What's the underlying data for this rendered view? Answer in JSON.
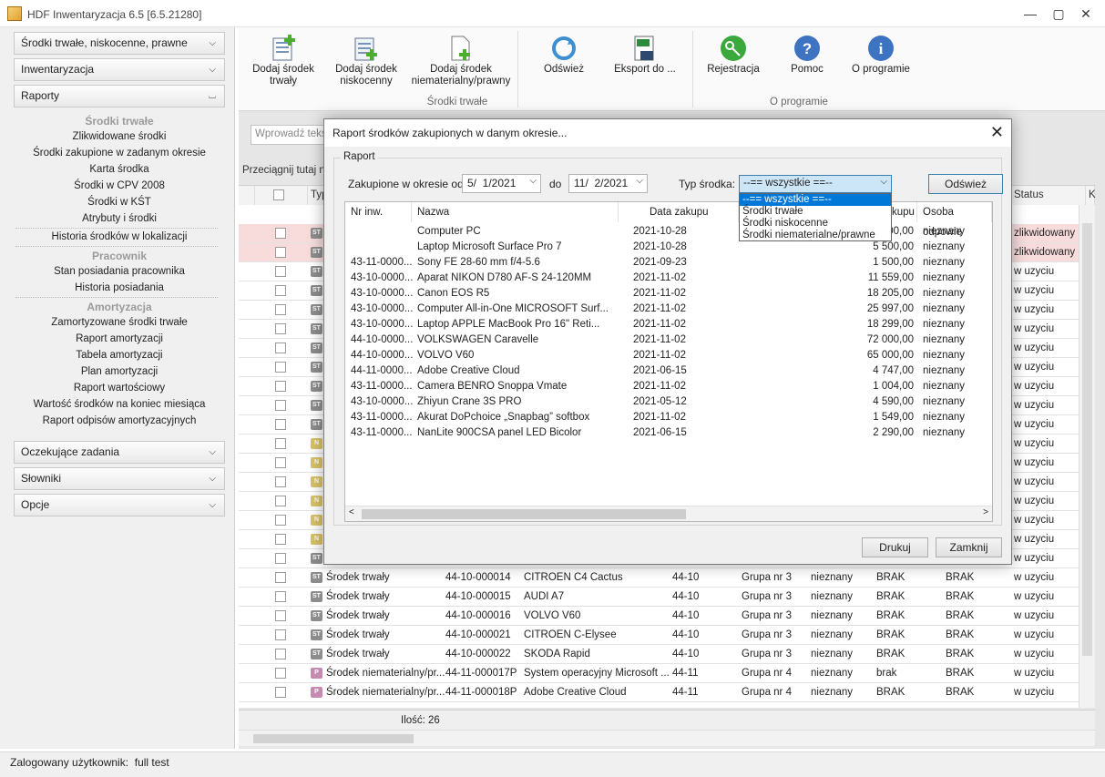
{
  "window": {
    "title": "HDF Inwentaryzacja 6.5 [6.5.21280]"
  },
  "sidebar": {
    "sections": [
      "Środki trwałe, niskocenne, prawne",
      "Inwentaryzacja",
      "Raporty"
    ],
    "groups": [
      "Środki trwałe",
      "Pracownik",
      "Amortyzacja"
    ],
    "links_trwale": [
      "Zlikwidowane środki",
      "Środki zakupione w zadanym okresie",
      "Karta środka",
      "Środki w CPV 2008",
      "Środki w KŚT",
      "Atrybuty i środki",
      "Historia środków w lokalizacji"
    ],
    "links_pracownik": [
      "Stan posiadania pracownika",
      "Historia posiadania"
    ],
    "links_amortyzacja": [
      "Zamortyzowane środki trwałe",
      "Raport amortyzacji",
      "Tabela amortyzacji",
      "Plan amortyzacji",
      "Raport wartościowy",
      "Wartość środków na koniec miesiąca",
      "Raport odpisów amortyzacyjnych"
    ],
    "bottom_sections": [
      "Oczekujące zadania",
      "Słowniki",
      "Opcje"
    ]
  },
  "ribbon": {
    "buttons": [
      {
        "label": "Dodaj środek\ntrwały",
        "icon": "add-fixed-asset-icon"
      },
      {
        "label": "Dodaj środek\nniskocenny",
        "icon": "add-low-value-asset-icon"
      },
      {
        "label": "Dodaj środek\nniematerialny/prawny",
        "icon": "add-intangible-asset-icon"
      },
      {
        "label": "Odśwież",
        "icon": "refresh-icon"
      },
      {
        "label": "Eksport do ...",
        "icon": "export-xls-icon"
      },
      {
        "label": "Rejestracja",
        "icon": "key-icon"
      },
      {
        "label": "Pomoc",
        "icon": "help-icon"
      },
      {
        "label": "O programie",
        "icon": "info-icon"
      }
    ],
    "groups": [
      "Środki trwałe",
      "O programie"
    ]
  },
  "grid": {
    "search_placeholder": "Wprowadź tekst",
    "drag_hint": "Przeciągnij tutaj na",
    "headers": {
      "type": "Typ",
      "status": "Status",
      "k": "K"
    },
    "rows": [
      {
        "badge": "ST",
        "type": "",
        "status": "zlikwidowany",
        "hl": true
      },
      {
        "badge": "ST",
        "type": "",
        "status": "zlikwidowany",
        "hl": true
      },
      {
        "badge": "ST",
        "type": "",
        "status": "w uzyciu"
      },
      {
        "badge": "ST",
        "type": "",
        "status": "w uzyciu"
      },
      {
        "badge": "ST",
        "type": "",
        "status": "w uzyciu"
      },
      {
        "badge": "ST",
        "type": "",
        "status": "w uzyciu"
      },
      {
        "badge": "ST",
        "type": "",
        "status": "w uzyciu"
      },
      {
        "badge": "ST",
        "type": "",
        "status": "w uzyciu"
      },
      {
        "badge": "ST",
        "type": "",
        "status": "w uzyciu"
      },
      {
        "badge": "ST",
        "type": "",
        "status": "w uzyciu"
      },
      {
        "badge": "ST",
        "type": "",
        "status": "w uzyciu"
      },
      {
        "badge": "N",
        "type": "",
        "status": "w uzyciu"
      },
      {
        "badge": "N",
        "type": "",
        "status": "w uzyciu"
      },
      {
        "badge": "N",
        "type": "",
        "status": "w uzyciu"
      },
      {
        "badge": "N",
        "type": "",
        "status": "w uzyciu"
      },
      {
        "badge": "N",
        "type": "",
        "status": "w uzyciu"
      },
      {
        "badge": "N",
        "type": "",
        "status": "w uzyciu"
      },
      {
        "badge": "ST",
        "type": "",
        "status": "w uzyciu"
      },
      {
        "badge": "ST",
        "type": "Środek trwały",
        "inv": "44-10-000014",
        "name": "CITROEN C4 Cactus",
        "kst": "44-10",
        "grp": "Grupa nr 3",
        "o1": "nieznany",
        "o2": "BRAK",
        "o3": "BRAK",
        "status": "w uzyciu"
      },
      {
        "badge": "ST",
        "type": "Środek trwały",
        "inv": "44-10-000015",
        "name": "AUDI A7",
        "kst": "44-10",
        "grp": "Grupa nr 3",
        "o1": "nieznany",
        "o2": "BRAK",
        "o3": "BRAK",
        "status": "w uzyciu"
      },
      {
        "badge": "ST",
        "type": "Środek trwały",
        "inv": "44-10-000016",
        "name": "VOLVO V60",
        "kst": "44-10",
        "grp": "Grupa nr 3",
        "o1": "nieznany",
        "o2": "BRAK",
        "o3": "BRAK",
        "status": "w uzyciu"
      },
      {
        "badge": "ST",
        "type": "Środek trwały",
        "inv": "44-10-000021",
        "name": "CITROEN C-Elysee",
        "kst": "44-10",
        "grp": "Grupa nr 3",
        "o1": "nieznany",
        "o2": "BRAK",
        "o3": "BRAK",
        "status": "w uzyciu"
      },
      {
        "badge": "ST",
        "type": "Środek trwały",
        "inv": "44-10-000022",
        "name": "SKODA Rapid",
        "kst": "44-10",
        "grp": "Grupa nr 3",
        "o1": "nieznany",
        "o2": "BRAK",
        "o3": "BRAK",
        "status": "w uzyciu"
      },
      {
        "badge": "P",
        "type": "Środek niematerialny/pr...",
        "inv": "44-11-000017P",
        "name": "System operacyjny Microsoft ...",
        "kst": "44-11",
        "grp": "Grupa nr 4",
        "o1": "nieznany",
        "o2": "brak",
        "o3": "BRAK",
        "status": "w uzyciu"
      },
      {
        "badge": "P",
        "type": "Środek niematerialny/pr...",
        "inv": "44-11-000018P",
        "name": "Adobe Creative Cloud",
        "kst": "44-11",
        "grp": "Grupa nr 4",
        "o1": "nieznany",
        "o2": "BRAK",
        "o3": "BRAK",
        "status": "w uzyciu"
      }
    ],
    "count": "Ilość: 26"
  },
  "statusbar": {
    "text": "Zalogowany użytkownik:  full test"
  },
  "dialog": {
    "title": "Raport środków zakupionych w danym okresie...",
    "legend": "Raport",
    "from_label": "Zakupione w okresie od",
    "from_date": "5/  1/2021",
    "to_label": "do",
    "to_date": "11/  2/2021",
    "type_label": "Typ środka:",
    "type_value": "--== wszystkie ==--",
    "type_options": [
      "--== wszystkie ==--",
      "Środki trwałe",
      "Środki niskocenne",
      "Środki niematerialne/prawne"
    ],
    "refresh": "Odśwież",
    "columns": [
      "Nr inw.",
      "Nazwa",
      "Data zakupu",
      "",
      "kupu",
      "Osoba odpowie"
    ],
    "rows": [
      {
        "inv": "",
        "name": "Computer PC",
        "date": "2021-10-28",
        "value": "00,00",
        "person": "nieznany"
      },
      {
        "inv": "",
        "name": "Laptop Microsoft Surface Pro 7",
        "date": "2021-10-28",
        "value": "5 500,00",
        "person": "nieznany"
      },
      {
        "inv": "43-11-0000...",
        "name": "Sony FE 28-60 mm f/4-5.6",
        "date": "2021-09-23",
        "value": "1 500,00",
        "person": "nieznany"
      },
      {
        "inv": "43-10-0000...",
        "name": "Aparat NIKON D780 AF-S 24-120MM",
        "date": "2021-11-02",
        "value": "11 559,00",
        "person": "nieznany"
      },
      {
        "inv": "43-10-0000...",
        "name": "Canon EOS R5",
        "date": "2021-11-02",
        "value": "18 205,00",
        "person": "nieznany"
      },
      {
        "inv": "43-10-0000...",
        "name": "Computer All-in-One MICROSOFT Surf...",
        "date": "2021-11-02",
        "value": "25 997,00",
        "person": "nieznany"
      },
      {
        "inv": "43-10-0000...",
        "name": "Laptop APPLE MacBook Pro 16\" Reti...",
        "date": "2021-11-02",
        "value": "18 299,00",
        "person": "nieznany"
      },
      {
        "inv": "44-10-0000...",
        "name": "VOLKSWAGEN Caravelle",
        "date": "2021-11-02",
        "value": "72 000,00",
        "person": "nieznany"
      },
      {
        "inv": "44-10-0000...",
        "name": "VOLVO V60",
        "date": "2021-11-02",
        "value": "65 000,00",
        "person": "nieznany"
      },
      {
        "inv": "44-11-0000...",
        "name": "Adobe Creative Cloud",
        "date": "2021-06-15",
        "value": "4 747,00",
        "person": "nieznany"
      },
      {
        "inv": "43-11-0000...",
        "name": "Camera BENRO Snoppa Vmate",
        "date": "2021-11-02",
        "value": "1 004,00",
        "person": "nieznany"
      },
      {
        "inv": "43-10-0000...",
        "name": "Zhiyun Crane 3S PRO",
        "date": "2021-05-12",
        "value": "4 590,00",
        "person": "nieznany"
      },
      {
        "inv": "43-11-0000...",
        "name": "Akurat DoPchoice „Snapbag” softbox",
        "date": "2021-11-02",
        "value": "1 549,00",
        "person": "nieznany"
      },
      {
        "inv": "43-11-0000...",
        "name": "NanLite 900CSA panel LED Bicolor",
        "date": "2021-06-15",
        "value": "2 290,00",
        "person": "nieznany"
      }
    ],
    "print": "Drukuj",
    "close": "Zamknij"
  }
}
